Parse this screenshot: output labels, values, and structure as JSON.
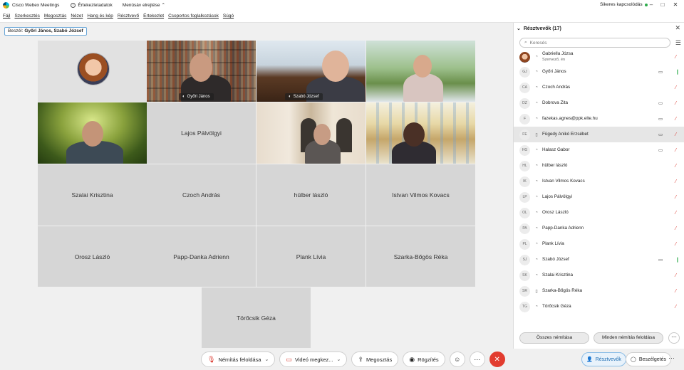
{
  "titlebar": {
    "app_title": "Cisco Webex Meetings",
    "info_label": "Értekezletadatok",
    "menubar_toggle": "Menüsáv elrejtése",
    "connection_status": "Sikeres kapcsolódás",
    "status_color": "#2bab4a"
  },
  "menu": [
    "Fájl",
    "Szerkesztés",
    "Megosztás",
    "Nézet",
    "Hang és kép",
    "Résztvevő",
    "Értekezlet",
    "Csoportos foglalkozások",
    "Súgó"
  ],
  "speaking": {
    "label": "Beszél:",
    "names": "Győri János, Szabó József"
  },
  "tiles": {
    "gyori": "Győri János",
    "szabo": "Szabó József",
    "palvolgyi": "Lajos Pálvölgyi",
    "szalai": "Szalai Krisztina",
    "czoch": "Czoch András",
    "hulber": "hülber lászló",
    "kovacs": "Istvan Vilmos Kovacs",
    "orosz": "Orosz László",
    "papp": "Papp-Danka Adrienn",
    "plank": "Plank Lívia",
    "szarka": "Szarka-Bőgös Réka",
    "torocsik": "Törőcsik Géza"
  },
  "controls": {
    "unmute": "Némítás feloldása",
    "stop_video": "Videó megkez...",
    "share": "Megosztás",
    "record": "Rögzítés"
  },
  "panel": {
    "title": "Résztvevők (17)",
    "search_placeholder": "Keresés",
    "mute_all": "Összes némítása",
    "unmute_all": "Minden némítás feloldása",
    "participants_button": "Résztvevők",
    "chat_button": "Beszélgetés",
    "participants": [
      {
        "initials": "",
        "name": "Gabriella Józsa",
        "sub": "Szervező, én",
        "device": "computer",
        "camera": false,
        "mic": "muted"
      },
      {
        "initials": "GJ",
        "name": "Győri János",
        "sub": "",
        "device": "computer",
        "camera": true,
        "mic": "on"
      },
      {
        "initials": "CA",
        "name": "Czoch András",
        "sub": "",
        "device": "computer",
        "camera": false,
        "mic": "muted"
      },
      {
        "initials": "DZ",
        "name": "Dobrova Zita",
        "sub": "",
        "device": "computer",
        "camera": true,
        "mic": "muted"
      },
      {
        "initials": "F",
        "name": "fazekas.agnes@ppk.elte.hu",
        "sub": "",
        "device": "computer",
        "camera": true,
        "mic": "muted"
      },
      {
        "initials": "FE",
        "name": "Fügedy Anikó Erzsébet",
        "sub": "",
        "device": "phone",
        "camera": true,
        "mic": "muted"
      },
      {
        "initials": "HG",
        "name": "Halasz Gabor",
        "sub": "",
        "device": "computer",
        "camera": true,
        "mic": "muted"
      },
      {
        "initials": "HL",
        "name": "hülber lászló",
        "sub": "",
        "device": "computer",
        "camera": false,
        "mic": "muted"
      },
      {
        "initials": "IK",
        "name": "Istvan Vilmos Kovacs",
        "sub": "",
        "device": "computer",
        "camera": false,
        "mic": "muted"
      },
      {
        "initials": "LP",
        "name": "Lajos Pálvölgyi",
        "sub": "",
        "device": "computer",
        "camera": false,
        "mic": "muted"
      },
      {
        "initials": "OL",
        "name": "Orosz László",
        "sub": "",
        "device": "computer",
        "camera": false,
        "mic": "muted"
      },
      {
        "initials": "PA",
        "name": "Papp-Danka Adrienn",
        "sub": "",
        "device": "computer",
        "camera": false,
        "mic": "muted"
      },
      {
        "initials": "PL",
        "name": "Plank Lívia",
        "sub": "",
        "device": "computer",
        "camera": false,
        "mic": "muted"
      },
      {
        "initials": "SJ",
        "name": "Szabó József",
        "sub": "",
        "device": "computer",
        "camera": true,
        "mic": "on"
      },
      {
        "initials": "SK",
        "name": "Szalai Krisztina",
        "sub": "",
        "device": "computer",
        "camera": false,
        "mic": "muted"
      },
      {
        "initials": "SR",
        "name": "Szarka-Bőgös Réka",
        "sub": "",
        "device": "phone",
        "camera": false,
        "mic": "muted"
      },
      {
        "initials": "TG",
        "name": "Törőcsik Géza",
        "sub": "",
        "device": "computer",
        "camera": false,
        "mic": "muted"
      }
    ]
  },
  "colors": {
    "accent": "#36a0e8",
    "muted_mic": "#d9352b",
    "end_button": "#e23c2f"
  }
}
